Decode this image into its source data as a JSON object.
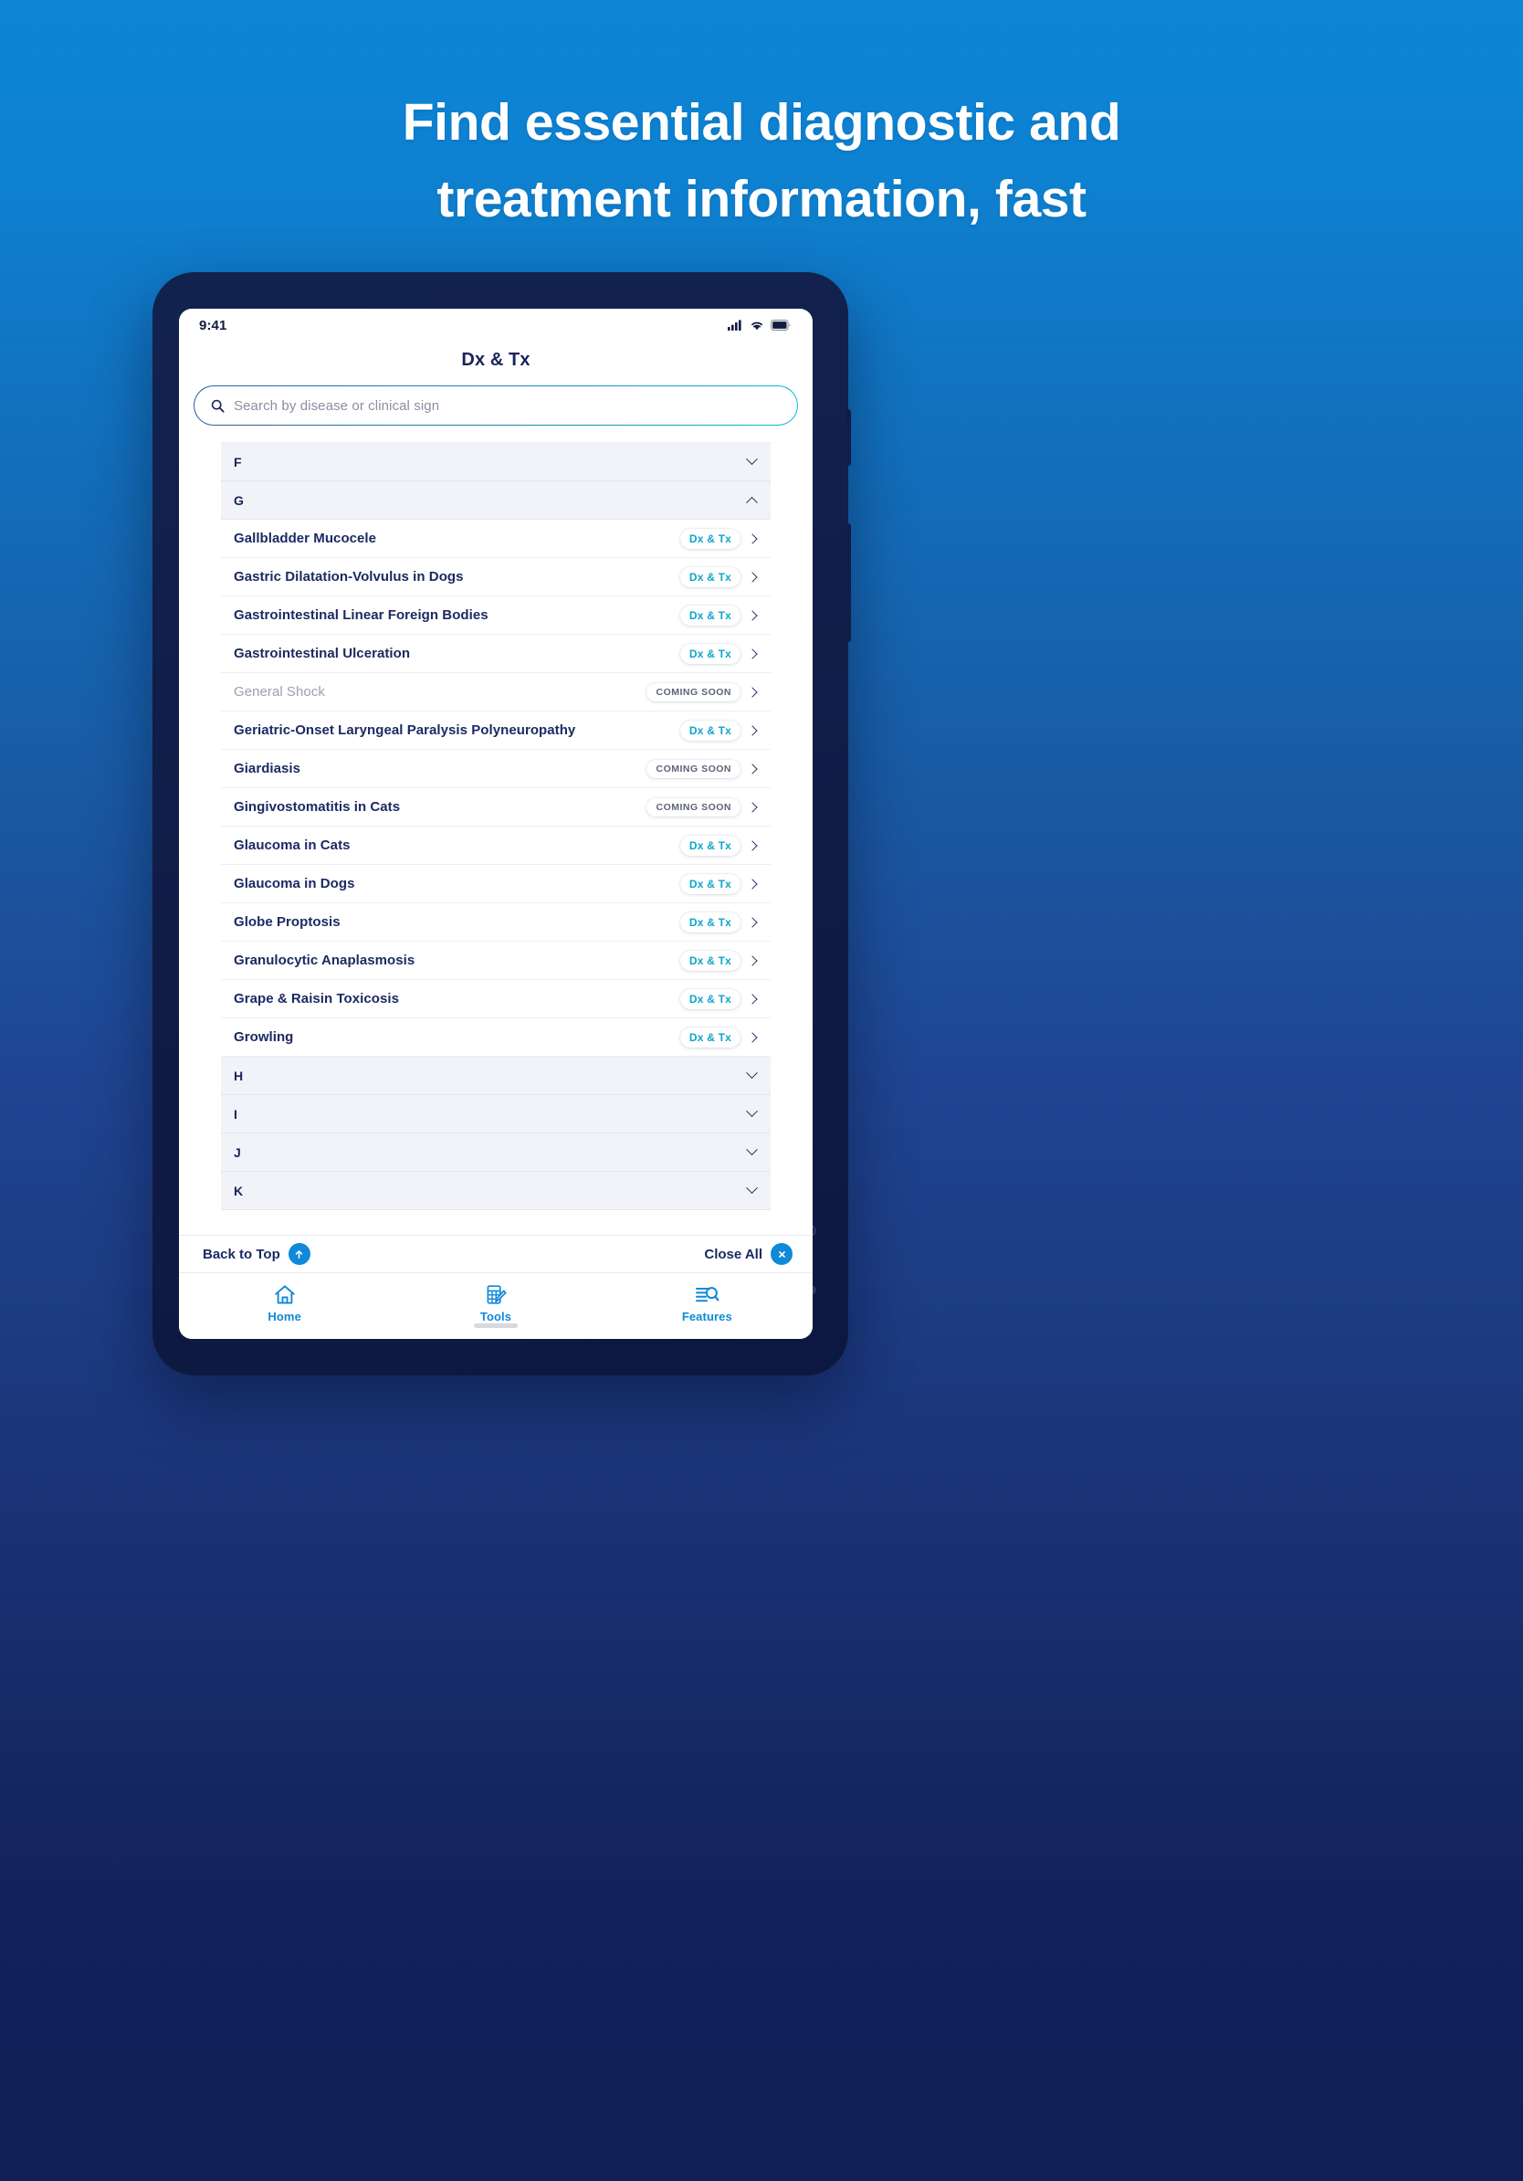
{
  "hero": {
    "line1": "Find essential diagnostic and",
    "line2": "treatment information, fast"
  },
  "colors": {
    "accent_blue": "#1089d8",
    "navy": "#1b2a63",
    "teal": "#0ea5c9",
    "muted": "#9aa0b4",
    "section_bg": "#f1f3f8"
  },
  "device": {
    "status": {
      "time": "9:41",
      "icons": [
        "cellular-signal-icon",
        "wifi-icon",
        "battery-icon"
      ]
    },
    "nav_title": "Dx & Tx",
    "search": {
      "placeholder": "Search by disease or clinical sign",
      "value": "",
      "icon": "search-icon"
    },
    "list": [
      {
        "kind": "section",
        "letter": "F",
        "expanded": false
      },
      {
        "kind": "section",
        "letter": "G",
        "expanded": true
      },
      {
        "kind": "row",
        "label": "Gallbladder Mucocele",
        "badge": "Dx & Tx",
        "badge_type": "dxtx",
        "muted": false
      },
      {
        "kind": "row",
        "label": "Gastric Dilatation-Volvulus in Dogs",
        "badge": "Dx & Tx",
        "badge_type": "dxtx",
        "muted": false
      },
      {
        "kind": "row",
        "label": "Gastrointestinal Linear Foreign Bodies",
        "badge": "Dx & Tx",
        "badge_type": "dxtx",
        "muted": false
      },
      {
        "kind": "row",
        "label": "Gastrointestinal Ulceration",
        "badge": "Dx & Tx",
        "badge_type": "dxtx",
        "muted": false
      },
      {
        "kind": "row",
        "label": "General Shock",
        "badge": "COMING SOON",
        "badge_type": "soon",
        "muted": true
      },
      {
        "kind": "row",
        "label": "Geriatric-Onset Laryngeal Paralysis Polyneuropathy",
        "badge": "Dx & Tx",
        "badge_type": "dxtx",
        "muted": false
      },
      {
        "kind": "row",
        "label": "Giardiasis",
        "badge": "COMING SOON",
        "badge_type": "soon",
        "muted": false
      },
      {
        "kind": "row",
        "label": "Gingivostomatitis in Cats",
        "badge": "COMING SOON",
        "badge_type": "soon",
        "muted": false
      },
      {
        "kind": "row",
        "label": "Glaucoma in Cats",
        "badge": "Dx & Tx",
        "badge_type": "dxtx",
        "muted": false
      },
      {
        "kind": "row",
        "label": "Glaucoma in Dogs",
        "badge": "Dx & Tx",
        "badge_type": "dxtx",
        "muted": false
      },
      {
        "kind": "row",
        "label": "Globe Proptosis",
        "badge": "Dx & Tx",
        "badge_type": "dxtx",
        "muted": false
      },
      {
        "kind": "row",
        "label": "Granulocytic Anaplasmosis",
        "badge": "Dx & Tx",
        "badge_type": "dxtx",
        "muted": false
      },
      {
        "kind": "row",
        "label": "Grape & Raisin Toxicosis",
        "badge": "Dx & Tx",
        "badge_type": "dxtx",
        "muted": false
      },
      {
        "kind": "row",
        "label": "Growling",
        "badge": "Dx & Tx",
        "badge_type": "dxtx",
        "muted": false
      },
      {
        "kind": "section",
        "letter": "H",
        "expanded": false
      },
      {
        "kind": "section",
        "letter": "I",
        "expanded": false
      },
      {
        "kind": "section",
        "letter": "J",
        "expanded": false
      },
      {
        "kind": "section",
        "letter": "K",
        "expanded": false
      }
    ],
    "util": {
      "back_to_top": "Back to Top",
      "back_to_top_icon": "arrow-up-icon",
      "close_all": "Close All",
      "close_all_icon": "close-x-icon"
    },
    "tabs": [
      {
        "label": "Home",
        "icon": "home-icon"
      },
      {
        "label": "Tools",
        "icon": "calculator-pencil-icon"
      },
      {
        "label": "Features",
        "icon": "list-search-icon"
      }
    ]
  }
}
